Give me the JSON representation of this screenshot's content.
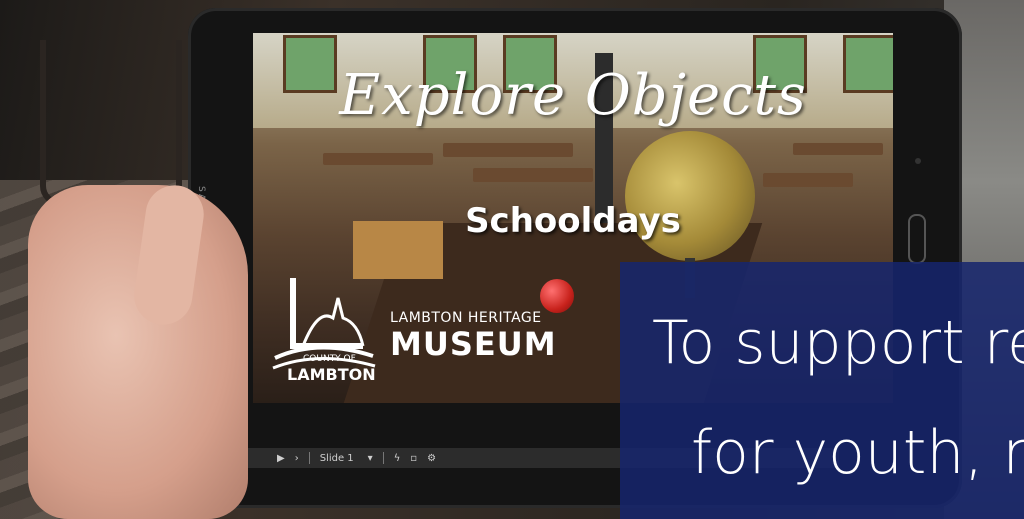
{
  "slide": {
    "title": "Explore Objects",
    "subtitle": "Schooldays",
    "logo_county_top": "COUNTY OF",
    "logo_county_name": "LAMBTON",
    "museum_line1": "LAMBTON HERITAGE",
    "museum_line2": "MUSEUM"
  },
  "tablet": {
    "brand": "SAMSUNG"
  },
  "controls": {
    "play_icon": "play-icon",
    "next_icon": "next-icon",
    "slide_label": "Slide 1",
    "slide_dropdown_icon": "chevron-down-icon",
    "flash_icon": "lightning-icon",
    "fullscreen_icon": "square-icon",
    "settings_icon": "gear-icon"
  },
  "overlay": {
    "line1": "To support re",
    "line2": "for youth, m"
  },
  "colors": {
    "overlay_bg": "#16256e",
    "text": "#ffffff"
  }
}
